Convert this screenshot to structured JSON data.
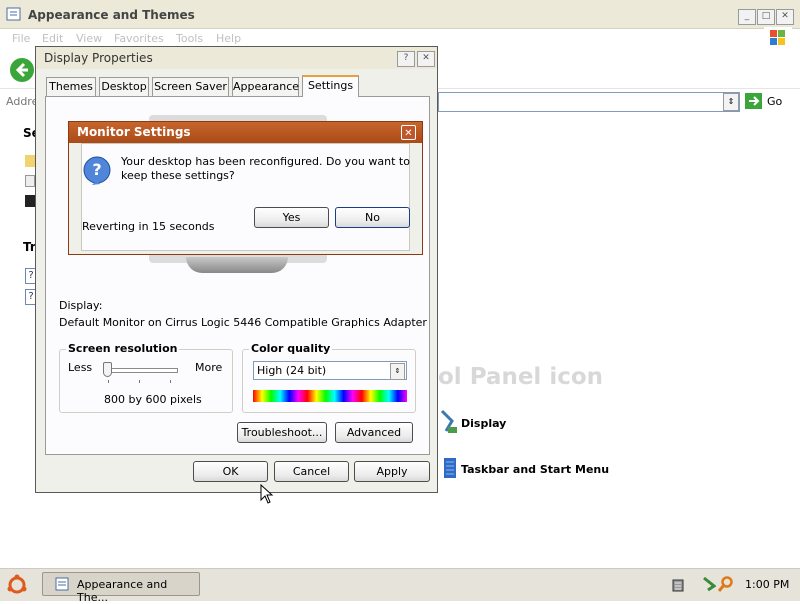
{
  "explorer": {
    "title": "Appearance and Themes",
    "menu": [
      "File",
      "Edit",
      "View",
      "Favorites",
      "Tools",
      "Help"
    ],
    "address_label": "Address",
    "go_label": "Go",
    "sidebar_see_also_partial": "Se",
    "sidebar_troubleshooters_partial": "Tr",
    "pick_icon_text": "ol Panel icon",
    "display_link": "Display",
    "taskbar_link": "Taskbar and Start Menu"
  },
  "display_props": {
    "title": "Display Properties",
    "tabs": [
      "Themes",
      "Desktop",
      "Screen Saver",
      "Appearance",
      "Settings"
    ],
    "active_tab": "Settings",
    "display_label": "Display:",
    "display_value": "Default Monitor on Cirrus Logic 5446 Compatible Graphics Adapter",
    "resolution_title": "Screen resolution",
    "less_label": "Less",
    "more_label": "More",
    "resolution_value": "800 by 600 pixels",
    "color_title": "Color quality",
    "color_value": "High (24 bit)",
    "troubleshoot_label": "Troubleshoot...",
    "advanced_label": "Advanced",
    "ok_label": "OK",
    "cancel_label": "Cancel",
    "apply_label": "Apply"
  },
  "monitor_dialog": {
    "title": "Monitor Settings",
    "message": "Your desktop has been reconfigured.  Do you want to keep these settings?",
    "countdown": "Reverting in 15 seconds",
    "yes_label": "Yes",
    "no_label": "No"
  },
  "taskbar": {
    "task_label": "Appearance and The...",
    "clock": "1:00 PM"
  },
  "colors": {
    "title_active": "#b0521d",
    "title_inactive": "#dcd8c8",
    "taskbar": "#e6e3db"
  }
}
